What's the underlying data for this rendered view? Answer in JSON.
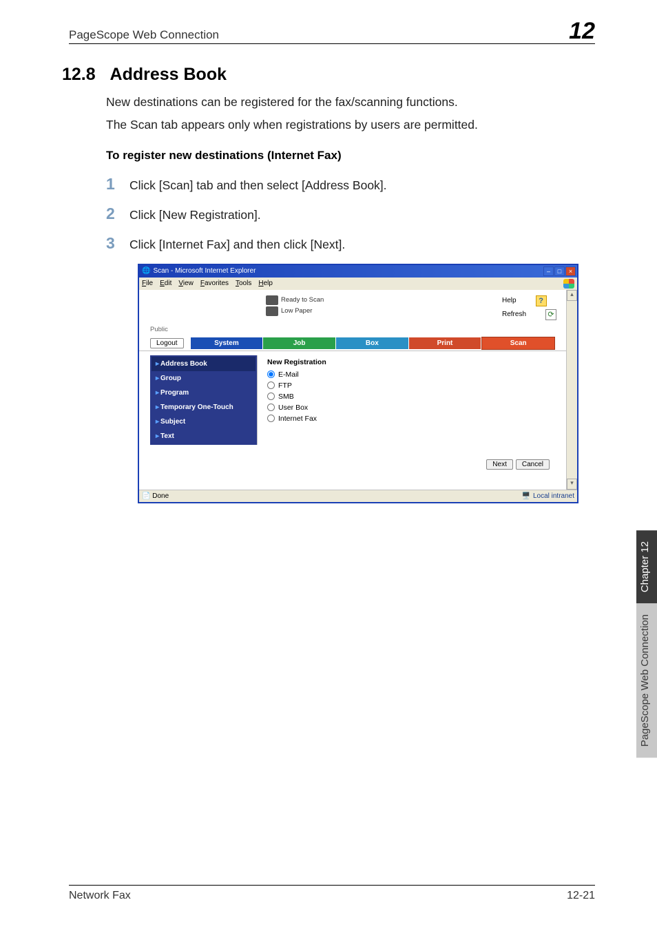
{
  "header": {
    "title": "PageScope Web Connection",
    "chapter_num": "12"
  },
  "section": {
    "number": "12.8",
    "title": "Address Book"
  },
  "paragraphs": {
    "p1": "New destinations can be registered for the fax/scanning functions.",
    "p2": "The Scan tab appears only when registrations by users are permitted."
  },
  "sub_heading": "To register new destinations (Internet Fax)",
  "steps": {
    "s1": {
      "num": "1",
      "text": "Click [Scan] tab and then select [Address Book]."
    },
    "s2": {
      "num": "2",
      "text": "Click [New Registration]."
    },
    "s3": {
      "num": "3",
      "text": "Click [Internet Fax] and then click [Next]."
    }
  },
  "ie": {
    "title": "Scan - Microsoft Internet Explorer",
    "menu": {
      "file": "File",
      "edit": "Edit",
      "view": "View",
      "favorites": "Favorites",
      "tools": "Tools",
      "help": "Help"
    },
    "status_left": "Done",
    "status_right": "Local intranet"
  },
  "app": {
    "printer": {
      "line1": "Ready to Scan",
      "line2": "Low Paper"
    },
    "help": "Help",
    "refresh": "Refresh",
    "public_label": "Public",
    "logout": "Logout",
    "tabs": {
      "system": "System",
      "job": "Job",
      "box": "Box",
      "print": "Print",
      "scan": "Scan"
    },
    "sidebar": {
      "address_book": "Address Book",
      "group": "Group",
      "program": "Program",
      "temp": "Temporary One-Touch",
      "subject": "Subject",
      "text": "Text"
    },
    "form": {
      "title": "New Registration",
      "opt1": "E-Mail",
      "opt2": "FTP",
      "opt3": "SMB",
      "opt4": "User Box",
      "opt5": "Internet Fax",
      "next": "Next",
      "cancel": "Cancel"
    }
  },
  "sidetab": {
    "dark": "Chapter 12",
    "light": "PageScope Web Connection"
  },
  "footer": {
    "left": "Network Fax",
    "right": "12-21"
  }
}
